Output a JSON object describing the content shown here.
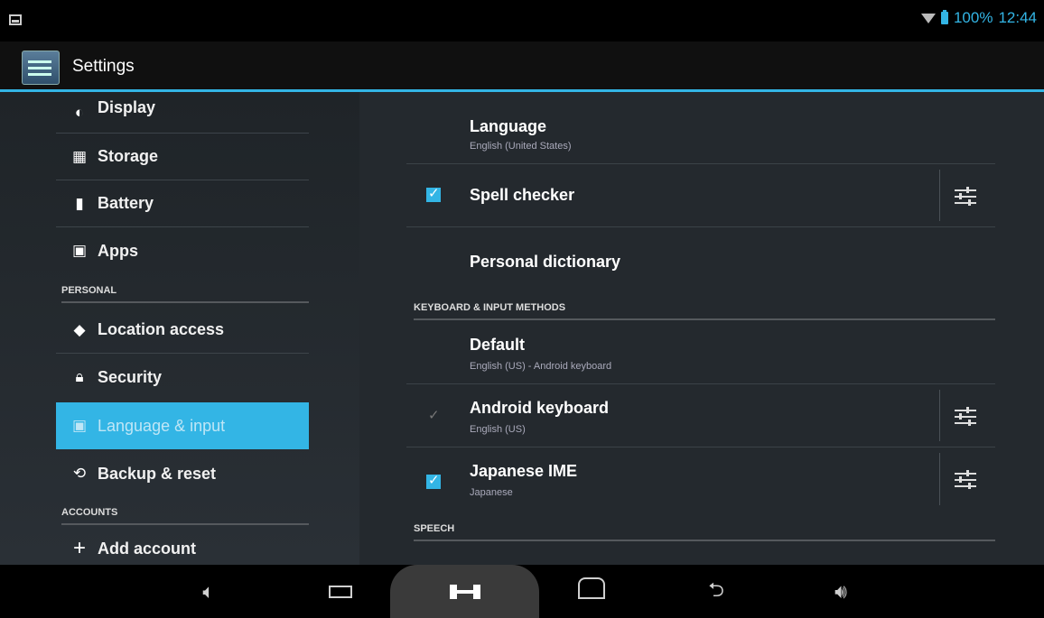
{
  "status_bar": {
    "battery_text": "100%",
    "time": "12:44",
    "icons": [
      "notification-icon",
      "wifi-icon",
      "battery-icon"
    ]
  },
  "action_bar": {
    "title": "Settings",
    "icon": "settings-app-icon"
  },
  "sidebar": {
    "items": [
      {
        "label": "Display",
        "icon": "display-icon"
      },
      {
        "label": "Storage",
        "icon": "storage-icon"
      },
      {
        "label": "Battery",
        "icon": "battery-icon"
      },
      {
        "label": "Apps",
        "icon": "apps-icon"
      },
      {
        "label": "Location access",
        "icon": "location-icon"
      },
      {
        "label": "Security",
        "icon": "lock-icon"
      },
      {
        "label": "Language & input",
        "icon": "language-icon",
        "selected": true
      },
      {
        "label": "Backup & reset",
        "icon": "backup-icon"
      },
      {
        "label": "Add account",
        "icon": "plus-icon"
      }
    ],
    "sections": {
      "personal": "PERSONAL",
      "accounts": "ACCOUNTS"
    }
  },
  "content": {
    "language": {
      "title": "Language",
      "subtitle": "English (United States)"
    },
    "spell_checker": {
      "title": "Spell checker",
      "checked": true
    },
    "personal_dictionary": {
      "title": "Personal dictionary"
    },
    "keyboard_section": "KEYBOARD & INPUT METHODS",
    "default": {
      "title": "Default",
      "subtitle": "English (US) - Android keyboard"
    },
    "android_keyboard": {
      "title": "Android keyboard",
      "subtitle": "English (US)",
      "checked": true,
      "enabled": false
    },
    "japanese_ime": {
      "title": "Japanese IME",
      "subtitle": "Japanese",
      "checked": true
    },
    "speech_section": "SPEECH"
  },
  "nav_bar": {
    "buttons": [
      "volume-down-icon",
      "recent-apps-icon",
      "screenshot-icon",
      "home-icon",
      "back-icon",
      "volume-up-icon"
    ]
  },
  "colors": {
    "accent": "#33b5e5",
    "panel_bg": "#24292e",
    "sidebar_bg": "#2a3036"
  }
}
